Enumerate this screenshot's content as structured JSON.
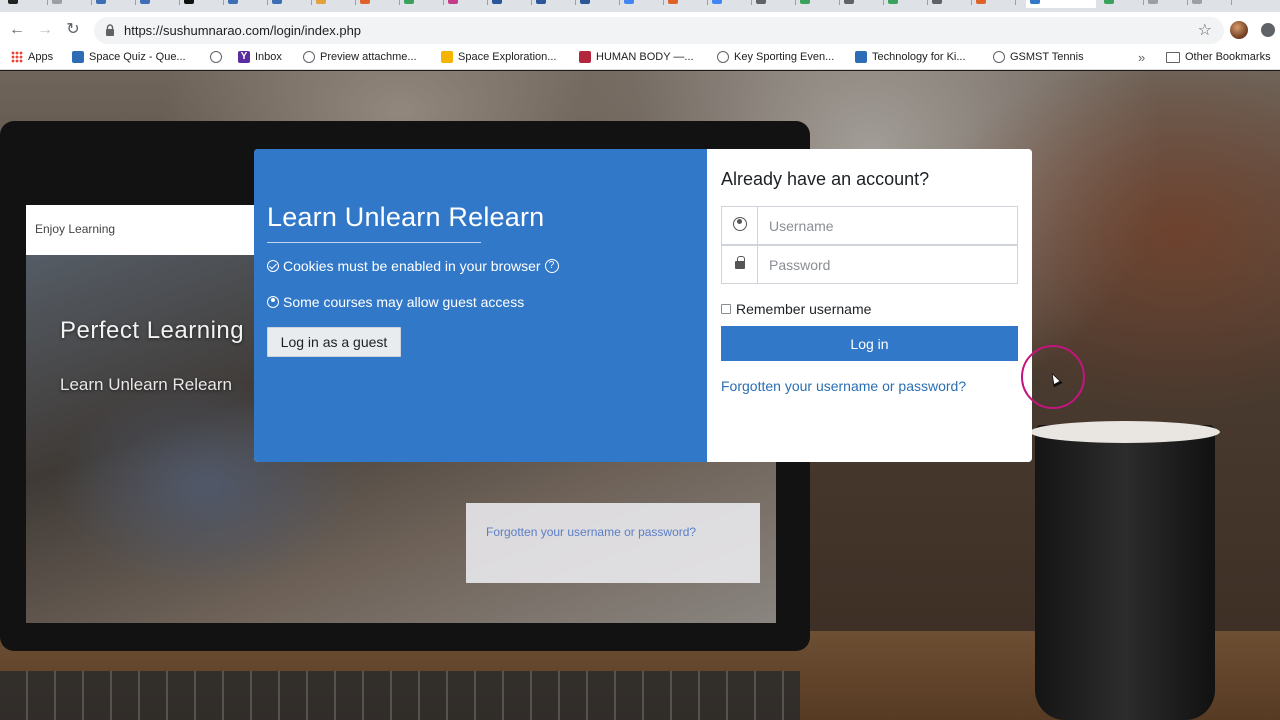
{
  "browser": {
    "url": "https://sushumnarao.com/login/index.php",
    "bookmarks": [
      {
        "label": "Apps",
        "icon": "apps-grid-icon"
      },
      {
        "label": "Space Quiz - Que...",
        "icon": "bookmark-favicon-icon"
      },
      {
        "label": "",
        "icon": "globe-icon"
      },
      {
        "label": "Inbox",
        "icon": "yahoo-icon"
      },
      {
        "label": "Preview attachme...",
        "icon": "globe-icon"
      },
      {
        "label": "Space Exploration...",
        "icon": "slides-icon"
      },
      {
        "label": "HUMAN BODY —...",
        "icon": "bookmark-favicon-icon"
      },
      {
        "label": "Key Sporting Even...",
        "icon": "globe-icon"
      },
      {
        "label": "Technology for Ki...",
        "icon": "bookmark-favicon-icon"
      },
      {
        "label": "GSMST Tennis",
        "icon": "globe-icon"
      }
    ],
    "bookmarks_more": "»",
    "other_bookmarks": "Other Bookmarks"
  },
  "background": {
    "brand": "Enjoy Learning",
    "headline": "Perfect Learning",
    "subheadline": "Learn Unlearn Relearn",
    "forgot_link": "Forgotten your username or password?"
  },
  "login": {
    "site_title": "Learn Unlearn Relearn",
    "cookies_notice": "Cookies must be enabled in your browser",
    "guest_notice": "Some courses may allow guest access",
    "guest_button": "Log in as a guest",
    "heading": "Already have an account?",
    "username_placeholder": "Username",
    "password_placeholder": "Password",
    "remember_label": "Remember username",
    "login_button": "Log in",
    "forgot_link": "Forgotten your username or password?"
  },
  "colors": {
    "primary": "#3278c8",
    "link": "#2a6fb3",
    "cursor_ring": "#c4157e"
  }
}
